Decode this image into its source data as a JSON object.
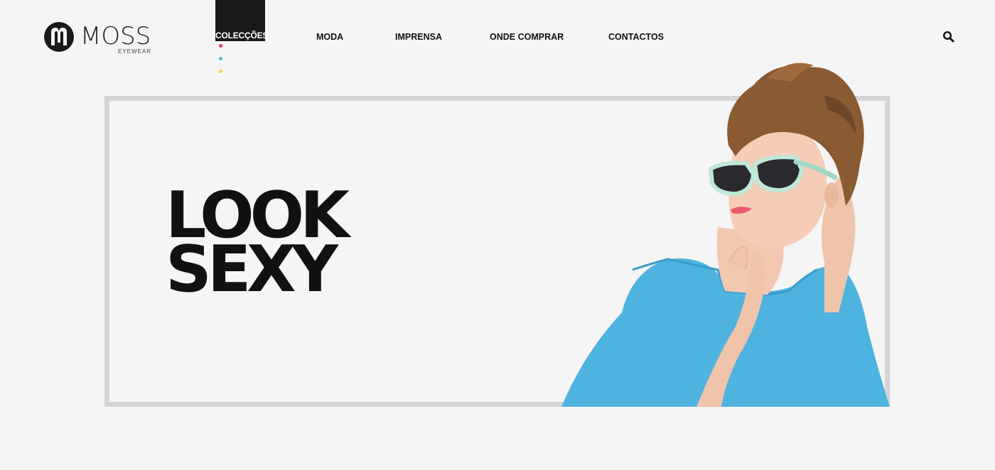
{
  "brand": {
    "name": "MOSS",
    "tagline": "EYEWEAR"
  },
  "nav": {
    "active": {
      "label": "COLECÇÕES",
      "dot_colors": [
        "#e8356f",
        "#4bbfc6",
        "#f2d53c"
      ]
    },
    "items": [
      {
        "label": "MODA"
      },
      {
        "label": "IMPRENSA"
      },
      {
        "label": "ONDE COMPRAR"
      },
      {
        "label": "CONTACTOS"
      }
    ],
    "search_icon": "search-icon"
  },
  "hero": {
    "line1": "LOOK",
    "line2": "SEXY",
    "image": "woman-with-mint-sunglasses"
  },
  "colors": {
    "background": "#f5f5f5",
    "frame": "#d5d5d5",
    "nav_active_bg": "#1a1a1a",
    "text": "#111111"
  }
}
